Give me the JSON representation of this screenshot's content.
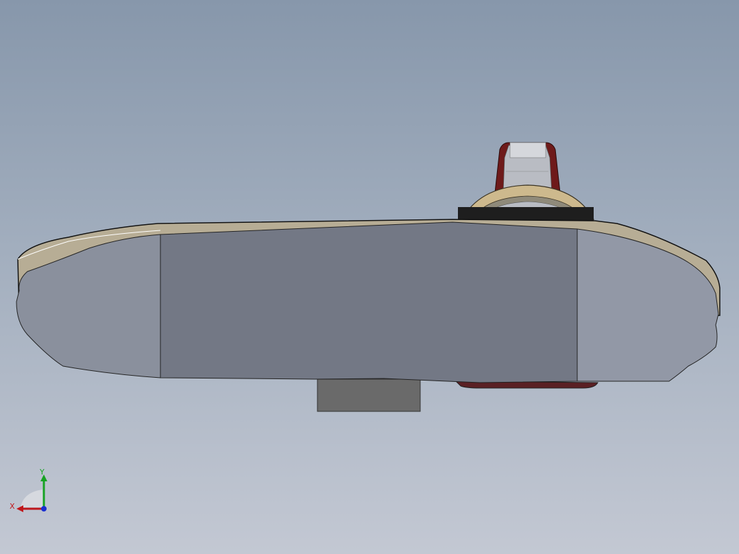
{
  "view": {
    "background_top": "#8797ab",
    "background_bottom": "#c3c8d3"
  },
  "model": {
    "body_color": "#737885",
    "end_color": "#9298a6",
    "rim_color": "#b7ad95",
    "edge_color": "#111111",
    "knob_accent": "#6e1a1a",
    "knob_cap": "#cfd1d6",
    "block_color": "#6a6a6a"
  },
  "triad": {
    "x_label": "X",
    "y_label": "Y",
    "x_color": "#c0181c",
    "y_color": "#17a323",
    "z_color": "#1a2fd0"
  }
}
